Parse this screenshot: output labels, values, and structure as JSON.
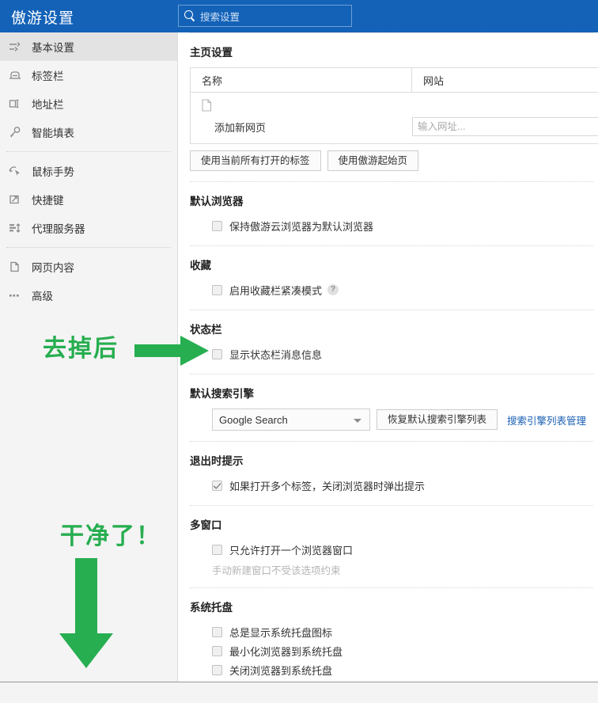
{
  "header": {
    "title": "傲游设置",
    "search": {
      "placeholder": "搜索设置",
      "icon": "search-icon"
    }
  },
  "sidebar": {
    "groups": [
      {
        "items": [
          {
            "label": "基本设置",
            "icon": "sliders-icon",
            "selected": true
          },
          {
            "label": "标签栏",
            "icon": "tab-icon",
            "selected": false
          },
          {
            "label": "地址栏",
            "icon": "address-bar-icon",
            "selected": false
          },
          {
            "label": "智能填表",
            "icon": "key-icon",
            "selected": false
          }
        ]
      },
      {
        "items": [
          {
            "label": "鼠标手势",
            "icon": "cursor-icon",
            "selected": false
          },
          {
            "label": "快捷键",
            "icon": "keyboard-shortcut-icon",
            "selected": false
          },
          {
            "label": "代理服务器",
            "icon": "proxy-sliders-icon",
            "selected": false
          }
        ]
      },
      {
        "items": [
          {
            "label": "网页内容",
            "icon": "document-icon",
            "selected": false
          },
          {
            "label": "高级",
            "icon": "ellipsis-icon",
            "selected": false
          }
        ]
      }
    ]
  },
  "sections": {
    "homepage": {
      "title": "主页设置",
      "columns": {
        "name": "名称",
        "site": "网站"
      },
      "new_row_label": "添加新网页",
      "url_placeholder": "输入网址...",
      "buttons": {
        "use_current_tabs": "使用当前所有打开的标签",
        "use_maxthon_start": "使用傲游起始页"
      }
    },
    "default_browser": {
      "title": "默认浏览器",
      "checkbox": {
        "label": "保持傲游云浏览器为默认浏览器",
        "checked": false
      }
    },
    "favorites": {
      "title": "收藏",
      "checkbox": {
        "label": "启用收藏栏紧凑模式",
        "checked": false
      },
      "help": "?"
    },
    "status_bar": {
      "title": "状态栏",
      "checkbox": {
        "label": "显示状态栏消息信息",
        "checked": false
      }
    },
    "search_engine": {
      "title": "默认搜索引擎",
      "selected": "Google Search",
      "restore_button": "恢复默认搜索引擎列表",
      "manage_link": "搜索引擎列表管理"
    },
    "exit_prompt": {
      "title": "退出时提示",
      "checkbox": {
        "label": "如果打开多个标签，关闭浏览器时弹出提示",
        "checked": true
      }
    },
    "multi_window": {
      "title": "多窗口",
      "checkbox": {
        "label": "只允许打开一个浏览器窗口",
        "checked": false
      },
      "hint": "手动新建窗口不受该选项约束"
    },
    "system_tray": {
      "title": "系统托盘",
      "checkboxes": [
        {
          "label": "总是显示系统托盘图标",
          "checked": false
        },
        {
          "label": "最小化浏览器到系统托盘",
          "checked": false
        },
        {
          "label": "关闭浏览器到系统托盘",
          "checked": false
        }
      ]
    }
  },
  "annotations": {
    "color": "#27ae50",
    "right": {
      "text": "去掉后",
      "arrow": "arrow-right-icon"
    },
    "down": {
      "text": "干净了！",
      "arrow": "arrow-down-icon"
    }
  }
}
